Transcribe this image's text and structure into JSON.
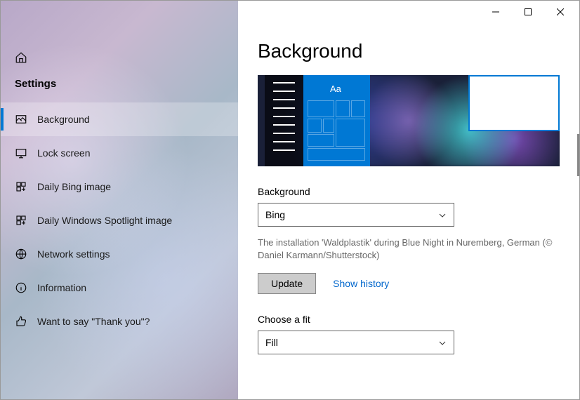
{
  "sidebar": {
    "title": "Settings",
    "items": [
      {
        "label": "Background",
        "icon": "image",
        "active": true
      },
      {
        "label": "Lock screen",
        "icon": "monitor",
        "active": false
      },
      {
        "label": "Daily Bing image",
        "icon": "grid",
        "active": false
      },
      {
        "label": "Daily Windows Spotlight image",
        "icon": "grid",
        "active": false
      },
      {
        "label": "Network settings",
        "icon": "globe",
        "active": false
      },
      {
        "label": "Information",
        "icon": "info",
        "active": false
      },
      {
        "label": "Want to say \"Thank you\"?",
        "icon": "thumbs-up",
        "active": false
      }
    ]
  },
  "main": {
    "page_title": "Background",
    "preview_aa": "Aa",
    "background_label": "Background",
    "background_value": "Bing",
    "caption": "The installation 'Waldplastik' during Blue Night in Nuremberg, German (© Daniel Karmann/Shutterstock)",
    "update_label": "Update",
    "show_history_label": "Show history",
    "fit_label": "Choose a fit",
    "fit_value": "Fill"
  }
}
